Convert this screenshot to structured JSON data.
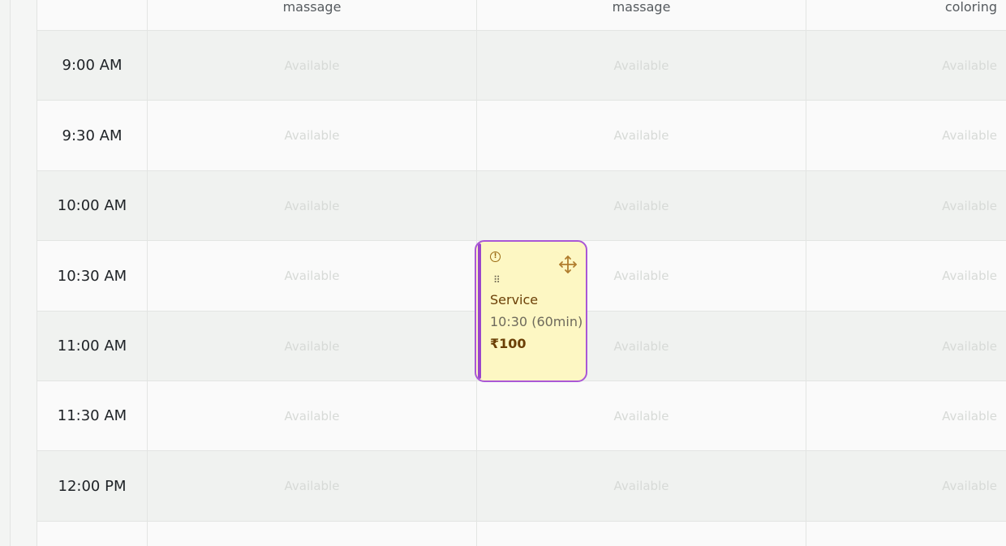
{
  "columns": [
    "massage",
    "massage",
    "coloring"
  ],
  "slot_label": "Available",
  "time_slots": [
    "9:00 AM",
    "9:30 AM",
    "10:00 AM",
    "10:30 AM",
    "11:00 AM",
    "11:30 AM",
    "12:00 PM",
    ""
  ],
  "appointment": {
    "title": "Service",
    "time": "10:30 (60min)",
    "price": "₹100",
    "status_icon": "alert-circle-icon",
    "drag_icon": "move-icon"
  },
  "colors": {
    "appointment_bg": "#fdf7c3",
    "appointment_border": "#a957d6",
    "text_brown": "#6b3f06"
  }
}
